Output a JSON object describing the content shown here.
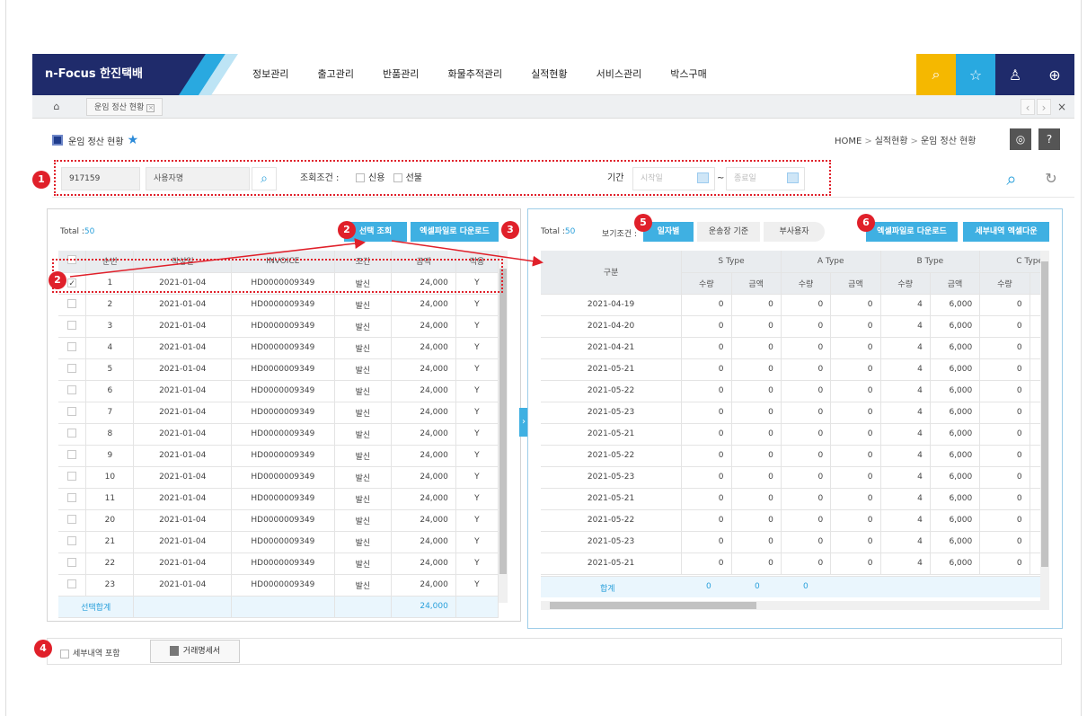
{
  "header": {
    "logo": "n-Focus 한진택배",
    "nav": [
      "정보관리",
      "출고관리",
      "반품관리",
      "화물추적관리",
      "실적현황",
      "서비스관리",
      "박스구매"
    ],
    "icons": [
      {
        "name": "search-icon",
        "glyph": "⌕",
        "bg": "#f5b800"
      },
      {
        "name": "favorite-icon",
        "glyph": "☆",
        "bg": "#29a9e0"
      },
      {
        "name": "user-icon",
        "glyph": "♙",
        "bg": "#1f2b6b"
      },
      {
        "name": "globe-icon",
        "glyph": "⊕",
        "bg": "#1f2b6b"
      }
    ]
  },
  "tabs": {
    "home_glyph": "⌂",
    "current": "운임 정산 현황",
    "close": "×",
    "prev": "‹",
    "next": "›",
    "close_all": "×"
  },
  "page": {
    "title": "운임 정산 현황",
    "breadcrumb": [
      "HOME",
      "실적현황",
      "운임 정산 현황"
    ]
  },
  "search": {
    "account": "917159",
    "user_placeholder": "사용자명",
    "cond_label": "조회조건 :",
    "cond_options": [
      "신용",
      "선불"
    ],
    "period_label": "기간",
    "start_placeholder": "시작일",
    "end_placeholder": "종료일",
    "tilde": "~"
  },
  "badges": [
    "1",
    "2",
    "2",
    "3",
    "4",
    "5",
    "6"
  ],
  "left": {
    "total_label": "Total :",
    "total_value": "50",
    "btn_select": "선택 조회",
    "btn_excel": "엑셀파일로 다운로드",
    "columns": [
      "",
      "순번",
      "작성일",
      "INVOICE",
      "조건",
      "금액",
      "적용"
    ],
    "rows": [
      {
        "no": "1",
        "date": "2021-01-04",
        "invoice": "HD0000009349",
        "cond": "발신",
        "amount": "24,000",
        "apply": "Y",
        "checked": true
      },
      {
        "no": "2",
        "date": "2021-01-04",
        "invoice": "HD0000009349",
        "cond": "발신",
        "amount": "24,000",
        "apply": "Y"
      },
      {
        "no": "3",
        "date": "2021-01-04",
        "invoice": "HD0000009349",
        "cond": "발신",
        "amount": "24,000",
        "apply": "Y"
      },
      {
        "no": "4",
        "date": "2021-01-04",
        "invoice": "HD0000009349",
        "cond": "발신",
        "amount": "24,000",
        "apply": "Y"
      },
      {
        "no": "5",
        "date": "2021-01-04",
        "invoice": "HD0000009349",
        "cond": "발신",
        "amount": "24,000",
        "apply": "Y"
      },
      {
        "no": "6",
        "date": "2021-01-04",
        "invoice": "HD0000009349",
        "cond": "발신",
        "amount": "24,000",
        "apply": "Y"
      },
      {
        "no": "7",
        "date": "2021-01-04",
        "invoice": "HD0000009349",
        "cond": "발신",
        "amount": "24,000",
        "apply": "Y"
      },
      {
        "no": "8",
        "date": "2021-01-04",
        "invoice": "HD0000009349",
        "cond": "발신",
        "amount": "24,000",
        "apply": "Y"
      },
      {
        "no": "9",
        "date": "2021-01-04",
        "invoice": "HD0000009349",
        "cond": "발신",
        "amount": "24,000",
        "apply": "Y"
      },
      {
        "no": "10",
        "date": "2021-01-04",
        "invoice": "HD0000009349",
        "cond": "발신",
        "amount": "24,000",
        "apply": "Y"
      },
      {
        "no": "11",
        "date": "2021-01-04",
        "invoice": "HD0000009349",
        "cond": "발신",
        "amount": "24,000",
        "apply": "Y"
      },
      {
        "no": "20",
        "date": "2021-01-04",
        "invoice": "HD0000009349",
        "cond": "발신",
        "amount": "24,000",
        "apply": "Y"
      },
      {
        "no": "21",
        "date": "2021-01-04",
        "invoice": "HD0000009349",
        "cond": "발신",
        "amount": "24,000",
        "apply": "Y"
      },
      {
        "no": "22",
        "date": "2021-01-04",
        "invoice": "HD0000009349",
        "cond": "발신",
        "amount": "24,000",
        "apply": "Y"
      },
      {
        "no": "23",
        "date": "2021-01-04",
        "invoice": "HD0000009349",
        "cond": "발신",
        "amount": "24,000",
        "apply": "Y"
      }
    ],
    "sum_label": "선택합계",
    "sum_amount": "24,000"
  },
  "right": {
    "total_label": "Total :",
    "total_value": "50",
    "view_label": "보기조건 :",
    "view_options": [
      "일자별",
      "운송장 기준",
      "부사용자"
    ],
    "btn_excel": "엑셀파일로 다운로드",
    "btn_detail_excel": "세부내역 엑셀다운",
    "col_group": "구분",
    "types": [
      "S Type",
      "A Type",
      "B Type",
      "C Type"
    ],
    "sub": [
      "수량",
      "금액"
    ],
    "rows": [
      {
        "date": "2021-04-19",
        "v": [
          "0",
          "0",
          "0",
          "0",
          "4",
          "6,000",
          "0"
        ]
      },
      {
        "date": "2021-04-20",
        "v": [
          "0",
          "0",
          "0",
          "0",
          "4",
          "6,000",
          "0"
        ]
      },
      {
        "date": "2021-04-21",
        "v": [
          "0",
          "0",
          "0",
          "0",
          "4",
          "6,000",
          "0"
        ]
      },
      {
        "date": "2021-05-21",
        "v": [
          "0",
          "0",
          "0",
          "0",
          "4",
          "6,000",
          "0"
        ]
      },
      {
        "date": "2021-05-22",
        "v": [
          "0",
          "0",
          "0",
          "0",
          "4",
          "6,000",
          "0"
        ]
      },
      {
        "date": "2021-05-23",
        "v": [
          "0",
          "0",
          "0",
          "0",
          "4",
          "6,000",
          "0"
        ]
      },
      {
        "date": "2021-05-21",
        "v": [
          "0",
          "0",
          "0",
          "0",
          "4",
          "6,000",
          "0"
        ]
      },
      {
        "date": "2021-05-22",
        "v": [
          "0",
          "0",
          "0",
          "0",
          "4",
          "6,000",
          "0"
        ]
      },
      {
        "date": "2021-05-23",
        "v": [
          "0",
          "0",
          "0",
          "0",
          "4",
          "6,000",
          "0"
        ]
      },
      {
        "date": "2021-05-21",
        "v": [
          "0",
          "0",
          "0",
          "0",
          "4",
          "6,000",
          "0"
        ]
      },
      {
        "date": "2021-05-22",
        "v": [
          "0",
          "0",
          "0",
          "0",
          "4",
          "6,000",
          "0"
        ]
      },
      {
        "date": "2021-05-23",
        "v": [
          "0",
          "0",
          "0",
          "0",
          "4",
          "6,000",
          "0"
        ]
      },
      {
        "date": "2021-05-21",
        "v": [
          "0",
          "0",
          "0",
          "0",
          "4",
          "6,000",
          "0"
        ]
      }
    ],
    "sum_label": "합계",
    "sum_values": [
      "0",
      "0",
      "0"
    ]
  },
  "bottom": {
    "include_detail": "세부내역 포함",
    "statement_btn": "거래명세서"
  },
  "colors": {
    "accent": "#3fb0e2",
    "navy": "#1f2b6b",
    "annotation": "#e0202a"
  }
}
